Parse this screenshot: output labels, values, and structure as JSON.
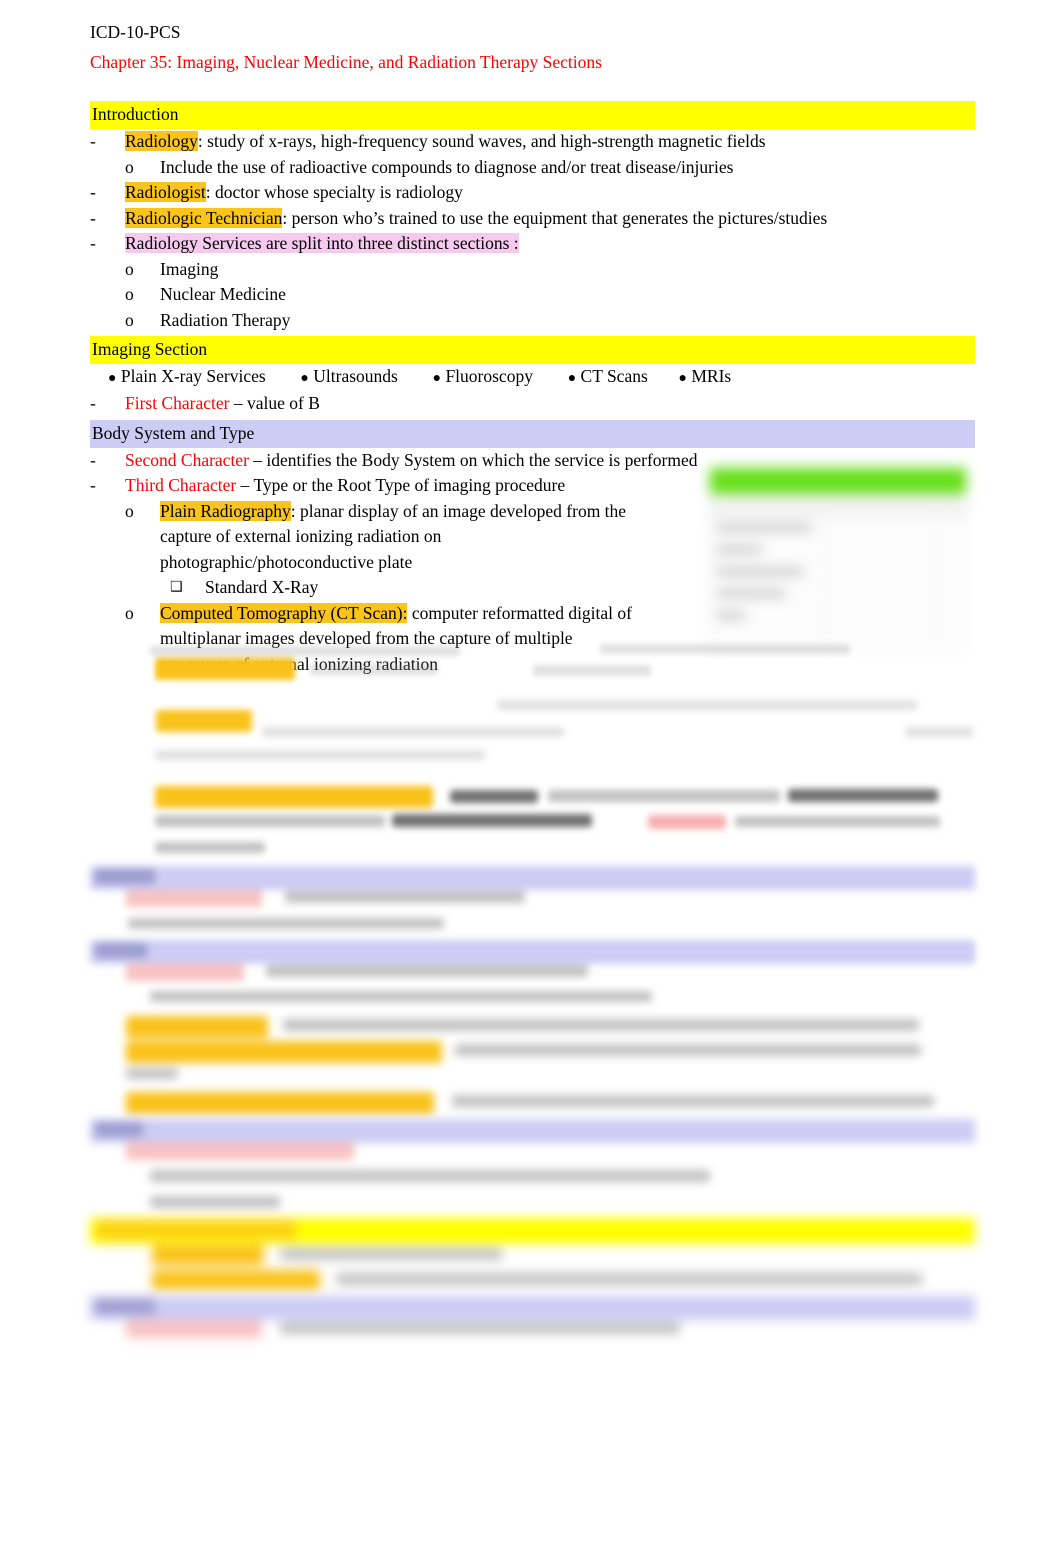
{
  "document": {
    "course_code": "ICD-10-PCS",
    "chapter_title": "Chapter 35: Imaging, Nuclear Medicine, and Radiation Therapy Sections"
  },
  "sections": {
    "introduction": {
      "heading": "Introduction",
      "items": [
        {
          "marker": "-",
          "term": "Radiology",
          "sep": ": ",
          "text": "study of x-rays, high-frequency sound waves, and high-strength magnetic fields",
          "highlight": "amber"
        },
        {
          "marker": "o",
          "term": "",
          "sep": "",
          "text": "Include the use of radioactive compounds to diagnose and/or treat disease/injuries",
          "highlight": "none"
        },
        {
          "marker": "-",
          "term": "Radiologist",
          "sep": ": ",
          "text": "doctor whose specialty is radiology",
          "highlight": "amber"
        },
        {
          "marker": "-",
          "term": "Radiologic Technician",
          "sep": ": ",
          "text": "person who’s trained to use the equipment that generates the pictures/studies",
          "highlight": "amber"
        },
        {
          "marker": "-",
          "term": "Radiology Services are split into three distinct sections  :",
          "sep": "",
          "text": "",
          "highlight": "pink"
        },
        {
          "marker": "o",
          "term": "",
          "sep": "",
          "text": "Imaging",
          "highlight": "none"
        },
        {
          "marker": "o",
          "term": "",
          "sep": "",
          "text": "Nuclear Medicine",
          "highlight": "none"
        },
        {
          "marker": "o",
          "term": "",
          "sep": "",
          "text": "Radiation Therapy",
          "highlight": "none"
        }
      ]
    },
    "imaging": {
      "heading": "Imaging Section",
      "service_bullets": [
        "Plain X-ray Services",
        "Ultrasounds",
        "Fluoroscopy",
        "CT Scans",
        "MRIs"
      ],
      "first_character": {
        "marker": "-",
        "label": "First Character",
        "text": " – value of B"
      }
    },
    "body_system_and_type": {
      "heading": "Body System and Type",
      "second_character": {
        "marker": "-",
        "label": "Second Character",
        "text": " – identifies the  Body System on which the service is performed"
      },
      "third_character": {
        "marker": "-",
        "label": "Third Character",
        "text": " – Type or the  Root Type of imaging procedure"
      },
      "plain_radiography": {
        "marker": "o",
        "term": "Plain Radiography",
        "sep": ": ",
        "line1": "planar display  of an image developed from the",
        "line2": "capture of  external ionizing radiation   on",
        "line3": "photographic/photoconductive plate",
        "sub_marker": "❑",
        "sub_text": "Standard X-Ray"
      },
      "computed_tomography": {
        "marker": "o",
        "term": "Computed Tomography (CT Scan):",
        "line1": " computer  reformatted digital of",
        "line2": "multiplanar images  developed from the capture of multiple",
        "line3": "exposures of  external ionizing radiation"
      }
    }
  },
  "colors": {
    "highlight_yellow": "#ffff00",
    "highlight_amber": "#fbc41d",
    "highlight_pink": "#f6c9ee",
    "highlight_lavender": "#ccccf4",
    "highlight_green": "#66e018",
    "accent_red": "#ff0000",
    "text": "#000000",
    "page_background": "#ffffff"
  }
}
